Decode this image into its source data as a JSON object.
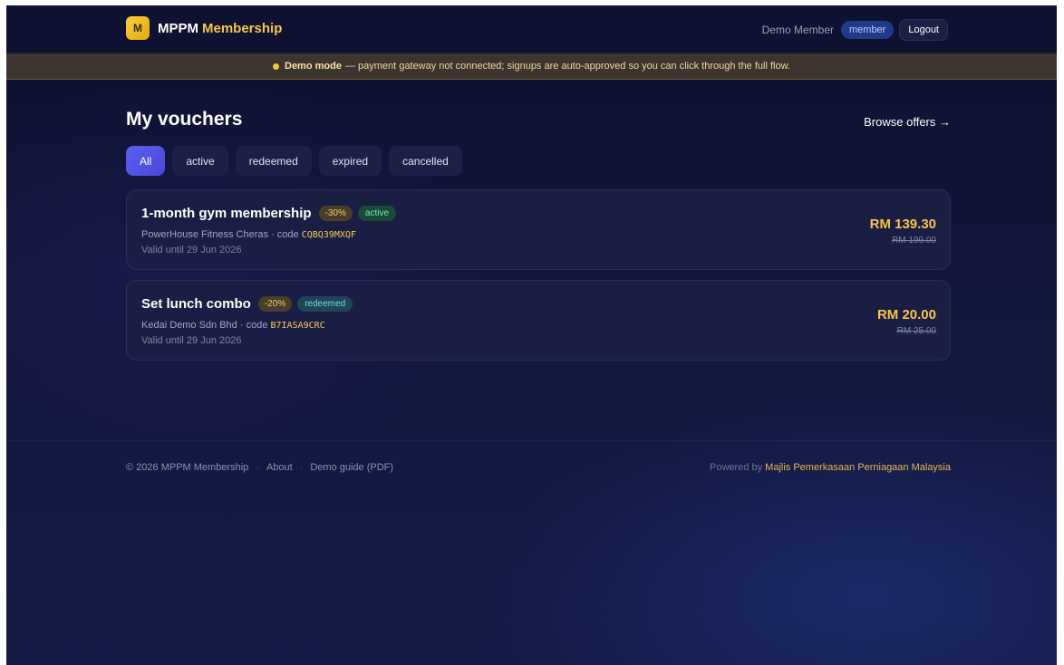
{
  "header": {
    "logo_letter": "M",
    "brand_name": "MPPM",
    "brand_accent": "Membership",
    "user_name": "Demo Member",
    "role": "member",
    "logout_label": "Logout"
  },
  "banner": {
    "strong": "Demo mode",
    "text": "— payment gateway not connected; signups are auto-approved so you can click through the full flow."
  },
  "main": {
    "title": "My vouchers",
    "browse_label": "Browse offers →",
    "filters": [
      "All",
      "active",
      "redeemed",
      "expired",
      "cancelled"
    ],
    "active_filter": "All",
    "vouchers": [
      {
        "title": "1-month gym membership",
        "discount": "-30%",
        "status": "active",
        "merchant": "PowerHouse Fitness Cheras · code",
        "code": "CQBQ39MXQF",
        "valid": "Valid until 29 Jun 2026",
        "price": "RM 139.30",
        "original_price": "RM 199.00"
      },
      {
        "title": "Set lunch combo",
        "discount": "-20%",
        "status": "redeemed",
        "merchant": "Kedai Demo Sdn Bhd · code",
        "code": "B7IASA9CRC",
        "valid": "Valid until 29 Jun 2026",
        "price": "RM 20.00",
        "original_price": "RM 25.00"
      }
    ]
  },
  "footer": {
    "copyright": "© 2026 MPPM Membership",
    "about": "About",
    "guide": "Demo guide (PDF)",
    "powered_by": "Powered by",
    "org": "Majlis Pemerkasaan Perniagaan Malaysia"
  },
  "colors": {
    "accent": "#f6c64a",
    "primary": "#5b5ff0",
    "background": "#11163a"
  }
}
